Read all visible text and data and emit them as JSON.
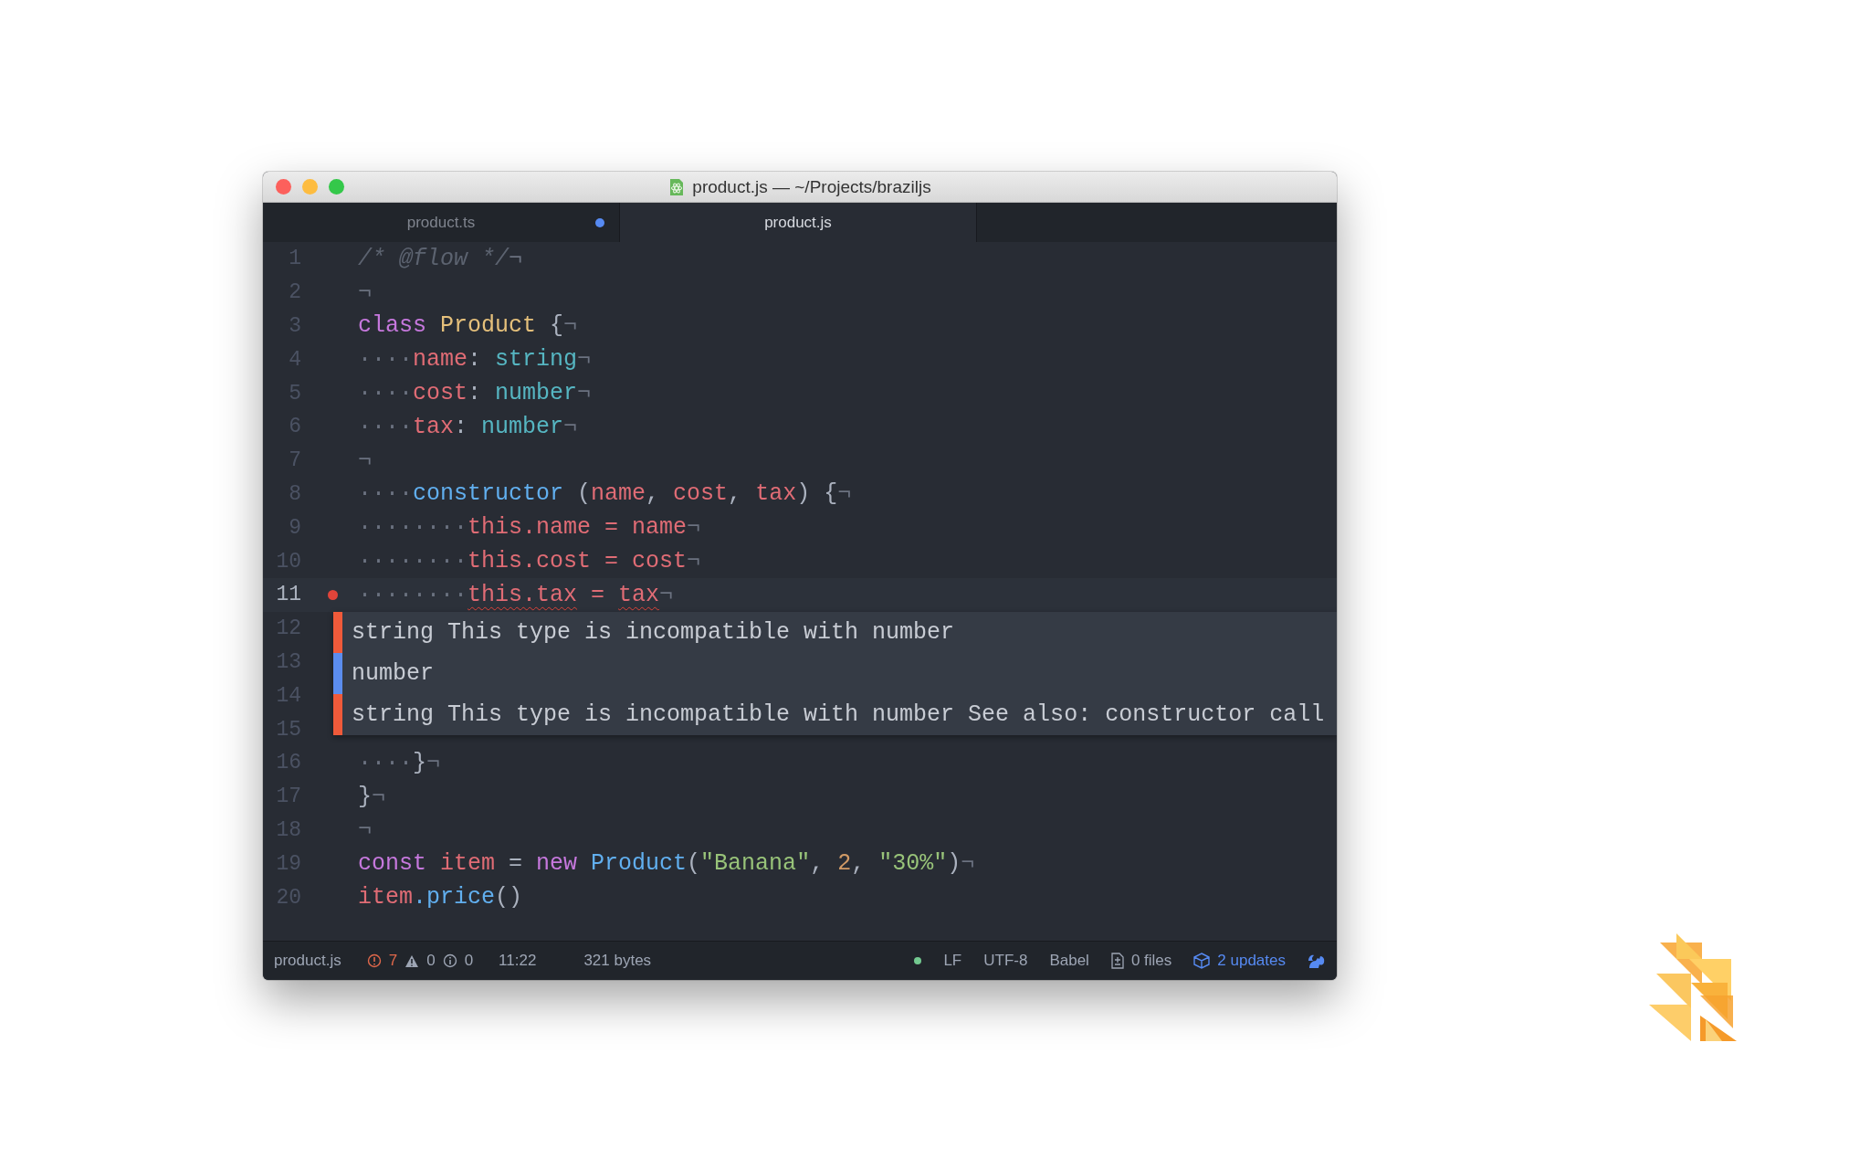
{
  "window": {
    "title": "product.js — ~/Projects/braziljs"
  },
  "tabs": [
    {
      "label": "product.ts",
      "selected": false,
      "modified": true
    },
    {
      "label": "product.js",
      "selected": true,
      "modified": false
    }
  ],
  "editor": {
    "lines": [
      {
        "number": "1",
        "current": false,
        "error": false,
        "tokens": [
          {
            "kind": "comment",
            "t": "/* @flow */"
          },
          {
            "kind": "invisible",
            "t": "¬"
          }
        ]
      },
      {
        "number": "2",
        "current": false,
        "error": false,
        "tokens": [
          {
            "kind": "invisible",
            "t": "¬"
          }
        ]
      },
      {
        "number": "3",
        "current": false,
        "error": false,
        "tokens": [
          {
            "kind": "keyword",
            "t": "class"
          },
          {
            "kind": "class",
            "t": " Product"
          },
          {
            "kind": "plain",
            "t": " {"
          },
          {
            "kind": "invisible",
            "t": "¬"
          }
        ]
      },
      {
        "number": "4",
        "current": false,
        "error": false,
        "tokens": [
          {
            "kind": "invisible",
            "t": "····"
          },
          {
            "kind": "variable",
            "t": "name"
          },
          {
            "kind": "plain",
            "t": ": "
          },
          {
            "kind": "type",
            "t": "string"
          },
          {
            "kind": "invisible",
            "t": "¬"
          }
        ]
      },
      {
        "number": "5",
        "current": false,
        "error": false,
        "tokens": [
          {
            "kind": "invisible",
            "t": "····"
          },
          {
            "kind": "variable",
            "t": "cost"
          },
          {
            "kind": "plain",
            "t": ": "
          },
          {
            "kind": "type",
            "t": "number"
          },
          {
            "kind": "invisible",
            "t": "¬"
          }
        ]
      },
      {
        "number": "6",
        "current": false,
        "error": false,
        "tokens": [
          {
            "kind": "invisible",
            "t": "····"
          },
          {
            "kind": "variable",
            "t": "tax"
          },
          {
            "kind": "plain",
            "t": ": "
          },
          {
            "kind": "type",
            "t": "number"
          },
          {
            "kind": "invisible",
            "t": "¬"
          }
        ]
      },
      {
        "number": "7",
        "current": false,
        "error": false,
        "tokens": [
          {
            "kind": "invisible",
            "t": "¬"
          }
        ]
      },
      {
        "number": "8",
        "current": false,
        "error": false,
        "tokens": [
          {
            "kind": "invisible",
            "t": "····"
          },
          {
            "kind": "function",
            "t": "constructor"
          },
          {
            "kind": "plain",
            "t": " ("
          },
          {
            "kind": "variable",
            "t": "name"
          },
          {
            "kind": "plain",
            "t": ", "
          },
          {
            "kind": "variable",
            "t": "cost"
          },
          {
            "kind": "plain",
            "t": ", "
          },
          {
            "kind": "variable",
            "t": "tax"
          },
          {
            "kind": "plain",
            "t": ") {"
          },
          {
            "kind": "invisible",
            "t": "¬"
          }
        ]
      },
      {
        "number": "9",
        "current": false,
        "error": false,
        "tokens": [
          {
            "kind": "invisible",
            "t": "········"
          },
          {
            "kind": "variable",
            "t": "this.name = name"
          },
          {
            "kind": "invisible",
            "t": "¬"
          }
        ]
      },
      {
        "number": "10",
        "current": false,
        "error": false,
        "tokens": [
          {
            "kind": "invisible",
            "t": "········"
          },
          {
            "kind": "variable",
            "t": "this.cost = cost"
          },
          {
            "kind": "invisible",
            "t": "¬"
          }
        ]
      },
      {
        "number": "11",
        "current": true,
        "error": true,
        "tokens": [
          {
            "kind": "invisible",
            "t": "········"
          },
          {
            "kind": "variable-error",
            "t": "this.tax"
          },
          {
            "kind": "variable",
            "t": " = "
          },
          {
            "kind": "variable-error",
            "t": "tax"
          },
          {
            "kind": "invisible",
            "t": "¬"
          }
        ]
      },
      {
        "number": "12",
        "current": false,
        "error": false
      },
      {
        "number": "13",
        "current": false,
        "error": false
      },
      {
        "number": "14",
        "current": false,
        "error": false
      },
      {
        "number": "15",
        "current": false,
        "error": false
      },
      {
        "number": "16",
        "current": false,
        "error": false,
        "tokens": [
          {
            "kind": "invisible",
            "t": "····"
          },
          {
            "kind": "plain",
            "t": "}"
          },
          {
            "kind": "invisible",
            "t": "¬"
          }
        ]
      },
      {
        "number": "17",
        "current": false,
        "error": false,
        "tokens": [
          {
            "kind": "plain",
            "t": "}"
          },
          {
            "kind": "invisible",
            "t": "¬"
          }
        ]
      },
      {
        "number": "18",
        "current": false,
        "error": false,
        "tokens": [
          {
            "kind": "invisible",
            "t": "¬"
          }
        ]
      },
      {
        "number": "19",
        "current": false,
        "error": false,
        "tokens": [
          {
            "kind": "keyword",
            "t": "const"
          },
          {
            "kind": "variable",
            "t": " item"
          },
          {
            "kind": "plain",
            "t": " = "
          },
          {
            "kind": "keyword",
            "t": "new"
          },
          {
            "kind": "function",
            "t": " Product"
          },
          {
            "kind": "plain",
            "t": "("
          },
          {
            "kind": "string",
            "t": "\"Banana\""
          },
          {
            "kind": "plain",
            "t": ", "
          },
          {
            "kind": "number",
            "t": "2"
          },
          {
            "kind": "plain",
            "t": ", "
          },
          {
            "kind": "string",
            "t": "\"30%\""
          },
          {
            "kind": "plain",
            "t": ")"
          },
          {
            "kind": "invisible",
            "t": "¬"
          }
        ]
      },
      {
        "number": "20",
        "current": false,
        "error": false,
        "tokens": [
          {
            "kind": "variable",
            "t": "item"
          },
          {
            "kind": "function",
            "t": ".price"
          },
          {
            "kind": "plain",
            "t": "()"
          }
        ]
      }
    ],
    "popup": {
      "messages": [
        {
          "text": "string This type is incompatible with number",
          "color": "#f05a3a"
        },
        {
          "text": "number",
          "color": "#5b8def"
        },
        {
          "text": "string This type is incompatible with number See also: constructor call",
          "color": "#f05a3a"
        }
      ]
    }
  },
  "status_bar": {
    "file": "product.js",
    "errors": "7",
    "warnings": "0",
    "infos": "0",
    "cursor": "11:22",
    "size": "321 bytes",
    "line_ending": "LF",
    "encoding": "UTF-8",
    "grammar": "Babel",
    "files": "0 files",
    "updates": "2 updates"
  }
}
